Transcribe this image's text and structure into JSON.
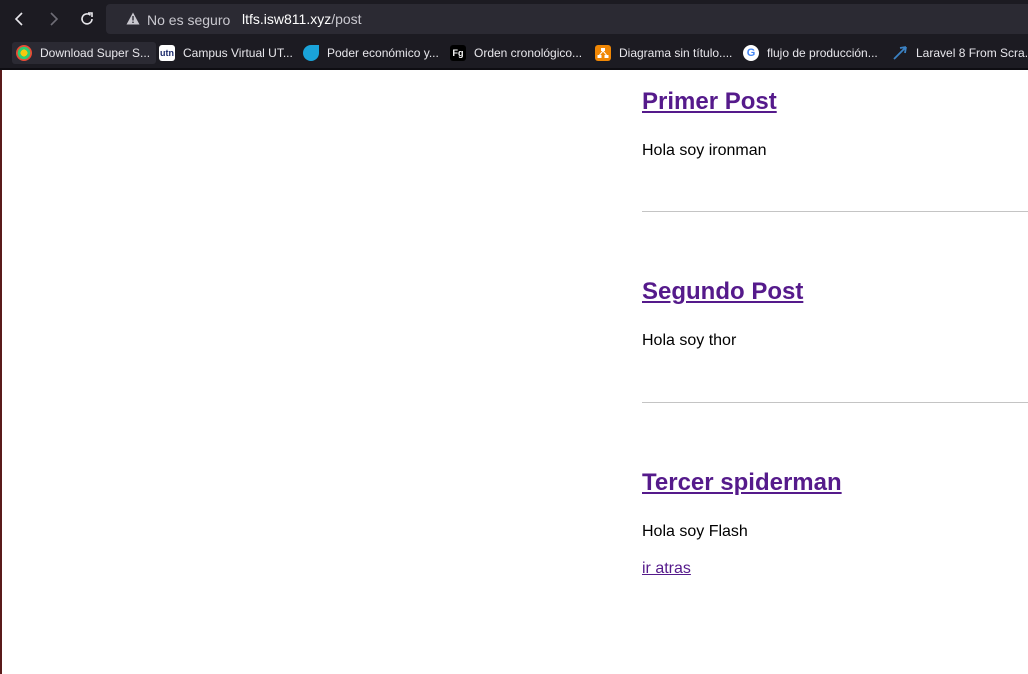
{
  "browser": {
    "security_label": "No es seguro",
    "url_host": "ltfs.isw811.xyz",
    "url_path": "/post",
    "bookmarks": [
      {
        "label": "Download Super S...",
        "icon": "colorful-app-icon",
        "color": "#e94b35"
      },
      {
        "label": "Campus Virtual UT...",
        "icon": "utn-logo-icon",
        "color": "#ffffff"
      },
      {
        "label": "Poder económico y...",
        "icon": "blue-leaf-icon",
        "color": "#1aa3d9"
      },
      {
        "label": "Orden cronológico...",
        "icon": "fg-logo-icon",
        "color": "#ffffff"
      },
      {
        "label": "Diagrama sin título....",
        "icon": "drawio-icon",
        "color": "#f08705"
      },
      {
        "label": "flujo de producción...",
        "icon": "google-icon",
        "color": "#4285f4"
      },
      {
        "label": "Laravel 8 From Scra...",
        "icon": "arrow-logo-icon",
        "color": "#3b82c4"
      }
    ]
  },
  "posts": [
    {
      "title": "Primer Post",
      "body": "Hola soy ironman"
    },
    {
      "title": "Segundo Post",
      "body": "Hola soy thor"
    },
    {
      "title": "Tercer spiderman",
      "body": "Hola soy Flash"
    }
  ],
  "back_link": "ir atras",
  "colors": {
    "link_visited": "#551a8b",
    "chrome_bg": "#1c1b22",
    "urlbar_bg": "#2b2a33"
  }
}
